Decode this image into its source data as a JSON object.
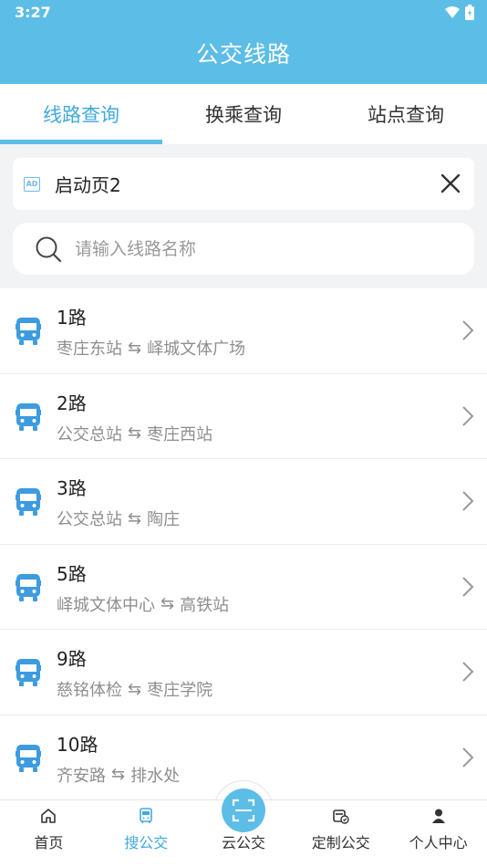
{
  "status_bar": {
    "time": "3:27"
  },
  "header": {
    "title": "公交线路"
  },
  "tabs": [
    {
      "label": "线路查询",
      "active": true
    },
    {
      "label": "换乘查询",
      "active": false
    },
    {
      "label": "站点查询",
      "active": false
    }
  ],
  "ad": {
    "badge": "AD",
    "text": "启动页2"
  },
  "search": {
    "placeholder": "请输入线路名称",
    "value": ""
  },
  "routes": [
    {
      "name": "1路",
      "from": "枣庄东站",
      "to": "峄城文体广场"
    },
    {
      "name": "2路",
      "from": "公交总站",
      "to": "枣庄西站"
    },
    {
      "name": "3路",
      "from": "公交总站",
      "to": "陶庄"
    },
    {
      "name": "5路",
      "from": "峄城文体中心",
      "to": "高铁站"
    },
    {
      "name": "9路",
      "from": "慈铭体检",
      "to": "枣庄学院"
    },
    {
      "name": "10路",
      "from": "齐安路",
      "to": "排水处"
    }
  ],
  "route_arrow": "⇆",
  "bottom_nav": [
    {
      "label": "首页",
      "icon": "home-icon",
      "active": false
    },
    {
      "label": "搜公交",
      "icon": "bus-icon",
      "active": true
    },
    {
      "label": "云公交",
      "icon": "scan-icon",
      "active": false
    },
    {
      "label": "定制公交",
      "icon": "custom-bus-icon",
      "active": false
    },
    {
      "label": "个人中心",
      "icon": "person-icon",
      "active": false
    }
  ],
  "colors": {
    "primary": "#5cbde6",
    "active_text": "#42a9de",
    "bus_icon": "#3d9be0"
  }
}
